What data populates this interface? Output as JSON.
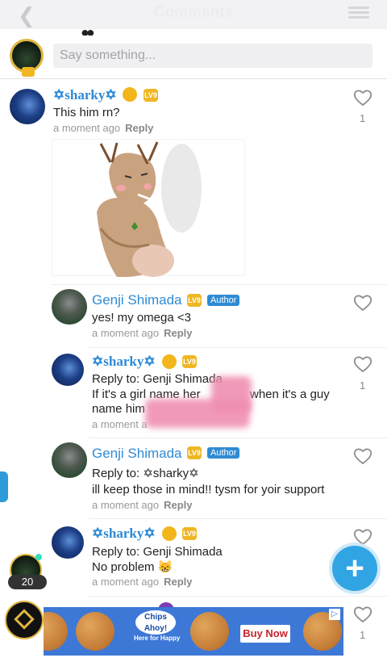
{
  "header": {
    "title": "Comments"
  },
  "input": {
    "placeholder": "Say something..."
  },
  "comments": [
    {
      "name": "✡sharky✡",
      "level": "LV9",
      "text": "This him rn?",
      "time": "a moment ago",
      "reply": "Reply",
      "likes": "1"
    },
    {
      "name": "Genji Shimada",
      "level": "LV9",
      "badge": "Author",
      "text": "yes! my omega <3",
      "time": "a moment ago",
      "reply": "Reply"
    },
    {
      "name": "✡sharky✡",
      "level": "LV9",
      "reply_to": "Reply to: Genji Shimada",
      "text1": "If it's a girl name her",
      "text1b": "when it's a guy",
      "text2": "name him",
      "time": "a moment a",
      "likes": "1"
    },
    {
      "name": "Genji Shimada",
      "level": "LV9",
      "badge": "Author",
      "reply_to": "Reply to: ✡sharky✡",
      "text": "ill keep those in mind!! tysm for yoir support",
      "time": "a moment ago",
      "reply": "Reply"
    },
    {
      "name": "✡sharky✡",
      "level": "LV9",
      "reply_to": "Reply to: Genji Shimada",
      "text": "No problem 😸",
      "time": "a moment ago",
      "reply": "Reply"
    }
  ],
  "peek": {
    "likes": "1"
  },
  "online": {
    "count": "20"
  },
  "ad": {
    "logo": "Chips Ahoy!",
    "tagline": "Here for Happy",
    "cta": "Buy Now"
  },
  "colors": {
    "accent": "#2f8bd4",
    "fab": "#31a5e3",
    "level": "#f0b623"
  }
}
